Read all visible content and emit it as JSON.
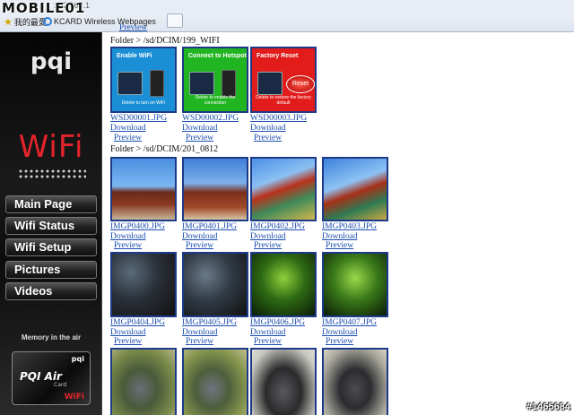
{
  "browser": {
    "logo": "MOBILE01",
    "address_fragment": "192.168.1",
    "favorites_label": "我的最愛",
    "tab_label": "KCARD Wireless Webpages"
  },
  "sidebar": {
    "brand": "pqi",
    "wifi_label": "WiFi",
    "nav": [
      {
        "label": "Main Page"
      },
      {
        "label": "Wifi Status"
      },
      {
        "label": "Wifi Setup"
      },
      {
        "label": "Pictures"
      },
      {
        "label": "Videos"
      }
    ],
    "tagline": "Memory in the air",
    "card": {
      "brand": "pqi",
      "name": "PQI Air",
      "sub": "Card",
      "wifi": "WiFi"
    }
  },
  "content": {
    "top_preview": "Preview",
    "folders": [
      {
        "label": "Folder > /sd/DCIM/199_WIFI",
        "files": [
          {
            "name": "WSD00001.JPG",
            "download": "Download",
            "preview": "Preview",
            "thumb_title": "Enable WiFi",
            "thumb_caption": "Delete to turn on WiFi",
            "color": "#1a8fd6"
          },
          {
            "name": "WSD00002.JPG",
            "download": "Download",
            "preview": "Preview",
            "thumb_title": "Connect to Hotspot",
            "thumb_caption": "Delete to enable the connection",
            "color": "#22b522"
          },
          {
            "name": "WSD00003.JPG",
            "download": "Download",
            "preview": "Preview",
            "thumb_title": "Factory Reset",
            "thumb_caption": "Delete to restore the factory default",
            "color": "#e21b1b",
            "button": "Reset"
          }
        ]
      },
      {
        "label": "Folder > /sd/DCIM/201_0812",
        "files": [
          {
            "name": "IMGP0400.JPG",
            "download": "Download",
            "preview": "Preview"
          },
          {
            "name": "IMGP0401.JPG",
            "download": "Download",
            "preview": "Preview"
          },
          {
            "name": "IMGP0402.JPG",
            "download": "Download",
            "preview": "Preview"
          },
          {
            "name": "IMGP0403.JPG",
            "download": "Download",
            "preview": "Preview"
          },
          {
            "name": "IMGP0404.JPG",
            "download": "Download",
            "preview": "Preview"
          },
          {
            "name": "IMGP0405.JPG",
            "download": "Download",
            "preview": "Preview"
          },
          {
            "name": "IMGP0406.JPG",
            "download": "Download",
            "preview": "Preview"
          },
          {
            "name": "IMGP0407.JPG",
            "download": "Download",
            "preview": "Preview"
          }
        ]
      }
    ]
  },
  "watermark": "#1465684"
}
